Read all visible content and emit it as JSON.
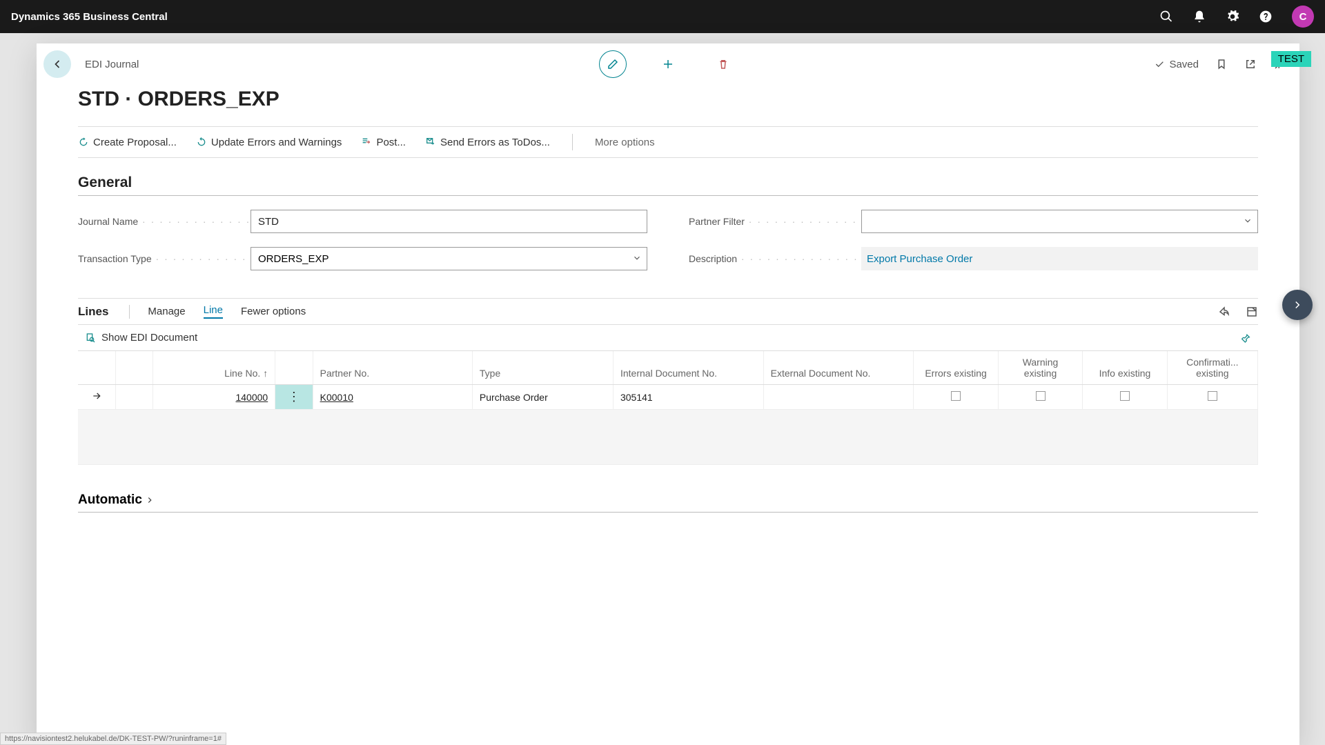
{
  "topbar": {
    "product": "Dynamics 365 Business Central",
    "avatar_initial": "C"
  },
  "test_badge": "TEST",
  "header": {
    "breadcrumb": "EDI Journal",
    "saved_label": "Saved"
  },
  "page_title": "STD · ORDERS_EXP",
  "ribbon": {
    "create_proposal": "Create Proposal...",
    "update_errors": "Update Errors and Warnings",
    "post": "Post...",
    "send_todos": "Send Errors as ToDos...",
    "more_options": "More options"
  },
  "general": {
    "section_title": "General",
    "journal_name_label": "Journal Name",
    "journal_name_value": "STD",
    "transaction_type_label": "Transaction Type",
    "transaction_type_value": "ORDERS_EXP",
    "partner_filter_label": "Partner Filter",
    "partner_filter_value": "",
    "description_label": "Description",
    "description_value": "Export Purchase Order"
  },
  "lines": {
    "title": "Lines",
    "manage": "Manage",
    "line": "Line",
    "fewer_options": "Fewer options",
    "show_edi_doc": "Show EDI Document",
    "columns": {
      "line_no": "Line No. ↑",
      "partner_no": "Partner No.",
      "type": "Type",
      "internal_doc": "Internal Document No.",
      "external_doc": "External Document No.",
      "errors_existing": "Errors existing",
      "warning_existing": "Warning existing",
      "info_existing": "Info existing",
      "confirmation_existing": "Confirmati... existing"
    },
    "rows": [
      {
        "line_no": "140000",
        "partner_no": "K00010",
        "type": "Purchase Order",
        "internal_doc": "305141",
        "external_doc": "",
        "errors": false,
        "warning": false,
        "info": false,
        "confirmation": false
      }
    ]
  },
  "automatic_label": "Automatic",
  "status_url": "https://navisiontest2.helukabel.de/DK-TEST-PW/?runinframe=1#"
}
